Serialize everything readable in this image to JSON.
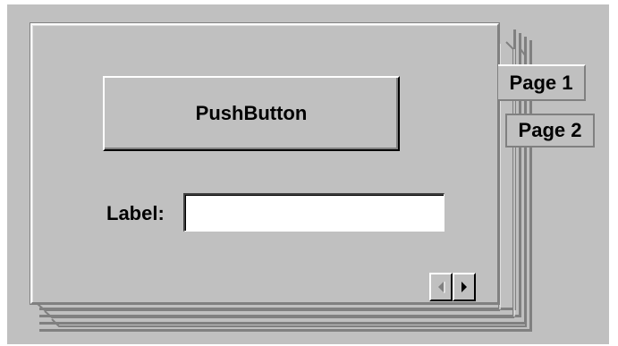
{
  "colors": {
    "face": "#c0c0c0",
    "highlight": "#ffffff",
    "shadow": "#808080",
    "dark_shadow": "#000000"
  },
  "notebook": {
    "push_button_label": "PushButton",
    "field_label": "Label:",
    "field_value": "",
    "tabs": [
      {
        "label": "Page 1",
        "selected": true
      },
      {
        "label": "Page 2",
        "selected": false
      }
    ],
    "nav": {
      "prev_icon": "arrow-left-icon",
      "next_icon": "arrow-right-icon",
      "prev_enabled": false,
      "next_enabled": true
    }
  }
}
